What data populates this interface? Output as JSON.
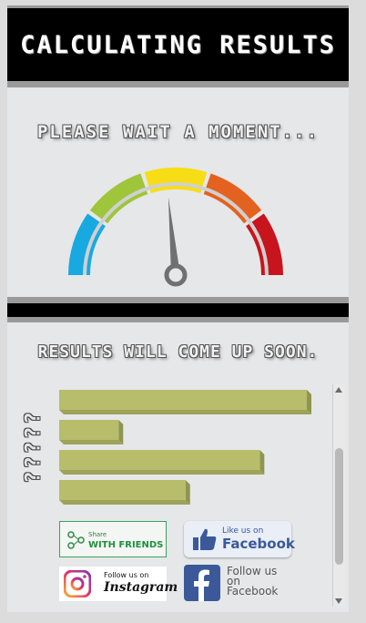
{
  "header": {
    "title": "CALCULATING RESULTS"
  },
  "status": {
    "wait_text": "PLEASE WAIT A MOMENT...",
    "soon_text": "RESULTS WILL COME UP SOON."
  },
  "gauge": {
    "segments": [
      {
        "color": "#18a9e0"
      },
      {
        "color": "#9fc53a"
      },
      {
        "color": "#f7dd16"
      },
      {
        "color": "#e4621f"
      },
      {
        "color": "#c8141c"
      }
    ],
    "needle_level": 0.47
  },
  "results": {
    "vertical_label": "?????",
    "bar_color": "#b8bd6b",
    "bar_values": [
      1.0,
      0.24,
      0.81,
      0.51
    ]
  },
  "social": {
    "share": {
      "small": "Share",
      "big": "WITH FRIENDS"
    },
    "fb_like": {
      "small": "Like us on",
      "big": "Facebook"
    },
    "instagram": {
      "small": "Follow us on",
      "big": "Instagram"
    },
    "fb_follow": {
      "label": "Follow us on Facebook"
    }
  }
}
